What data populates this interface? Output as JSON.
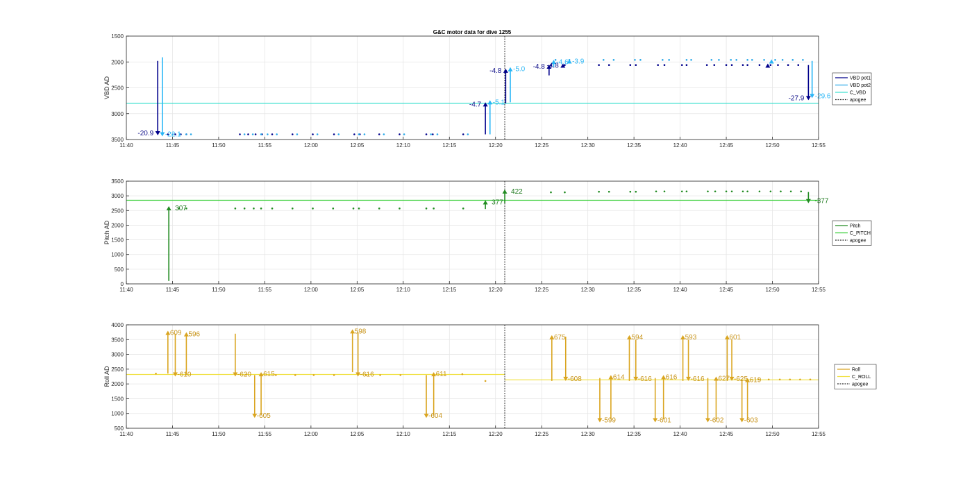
{
  "chart_data": [
    {
      "type": "scatter",
      "title": "G&C motor data for dive 1255",
      "ylabel": "VBD AD",
      "y_reversed": true,
      "ylim": [
        1500,
        3500
      ],
      "yticks": [
        1500,
        2000,
        2500,
        3000,
        3500
      ],
      "xlim": [
        "11:40",
        "12:55"
      ],
      "xticks": [
        "11:40",
        "11:45",
        "11:50",
        "11:55",
        "12:00",
        "12:05",
        "12:10",
        "12:15",
        "12:20",
        "12:25",
        "12:30",
        "12:35",
        "12:40",
        "12:45",
        "12:50",
        "12:55"
      ],
      "grid": true,
      "legend_position": "right",
      "legend": [
        "VBD pot1",
        "VBD pot2",
        "C_VBD",
        "apogee"
      ],
      "colors": {
        "pot1": "#00008b",
        "pot2": "#1e90ff",
        "c_vbd": "#40e0d0",
        "apogee": "#333333"
      },
      "reference_line": {
        "name": "C_VBD",
        "value": 2800
      },
      "apogee": "12:21",
      "pot1_points": {
        "x": [
          "11:44.5",
          "11:45.3",
          "11:45.9",
          "11:46.5",
          "11:52.3",
          "11:53.2",
          "11:54.0",
          "11:54.7",
          "11:55.8",
          "11:58.0",
          "12:00.2",
          "12:02.5",
          "12:04.7",
          "12:05.3",
          "12:07.4",
          "12:09.6",
          "12:12.5",
          "12:13.2",
          "12:16.5",
          "12:26.0",
          "12:27.5",
          "12:31.2",
          "12:32.3",
          "12:34.6",
          "12:35.2",
          "12:37.6",
          "12:38.3",
          "12:40.2",
          "12:40.7",
          "12:42.9",
          "12:43.7",
          "12:45.0",
          "12:45.6",
          "12:46.8",
          "12:47.3",
          "12:48.6",
          "12:49.8",
          "12:50.6",
          "12:51.7",
          "12:52.8"
        ],
        "y": [
          3400,
          3400,
          3400,
          3400,
          3400,
          3400,
          3400,
          3400,
          3400,
          3400,
          3400,
          3400,
          3400,
          3400,
          3400,
          3400,
          3400,
          3400,
          3400,
          2060,
          2060,
          2060,
          2060,
          2060,
          2060,
          2060,
          2060,
          2060,
          2060,
          2060,
          2060,
          2060,
          2060,
          2060,
          2060,
          2060,
          2060,
          2060,
          2060,
          2060
        ]
      },
      "pot2_points": {
        "x": [
          "11:45.0",
          "11:45.8",
          "11:46.5",
          "11:47.0",
          "11:52.8",
          "11:53.7",
          "11:54.6",
          "11:55.3",
          "11:56.3",
          "11:58.5",
          "12:00.7",
          "12:03.0",
          "12:05.2",
          "12:05.8",
          "12:07.9",
          "12:10.1",
          "12:13.0",
          "12:13.7",
          "12:17.0",
          "12:26.5",
          "12:28.0",
          "12:31.7",
          "12:32.8",
          "12:35.1",
          "12:35.7",
          "12:38.1",
          "12:38.8",
          "12:40.7",
          "12:41.2",
          "12:43.4",
          "12:44.2",
          "12:45.5",
          "12:46.1",
          "12:47.3",
          "12:47.8",
          "12:49.1",
          "12:50.3",
          "12:51.1",
          "12:52.2",
          "12:53.3"
        ],
        "y": [
          3400,
          3400,
          3400,
          3400,
          3400,
          3400,
          3400,
          3400,
          3400,
          3400,
          3400,
          3400,
          3400,
          3400,
          3400,
          3400,
          3400,
          3400,
          3400,
          1960,
          1960,
          1960,
          1960,
          1960,
          1960,
          1960,
          1960,
          1960,
          1960,
          1960,
          1960,
          1960,
          1960,
          1960,
          1960,
          1960,
          1960,
          1960,
          1960,
          1960
        ]
      },
      "pot1_arrows": [
        {
          "x": "11:43.4",
          "y0": 1980,
          "y1": 3420,
          "label": "-20.9"
        },
        {
          "x": "12:18.9",
          "y0": 3400,
          "y1": 2780,
          "label": "-4.7"
        },
        {
          "x": "12:21.1",
          "y0": 2800,
          "y1": 2130,
          "label": "-4.8"
        },
        {
          "x": "12:25.8",
          "y0": 2260,
          "y1": 2050,
          "label": "-4.8"
        },
        {
          "x": "12:27.3",
          "y0": 2110,
          "y1": 2030,
          "label": "-4.8"
        },
        {
          "x": "12:49.5",
          "y0": 2060,
          "y1": 2030,
          "label": ""
        },
        {
          "x": "12:53.9",
          "y0": 2060,
          "y1": 2740,
          "label": "-27.9"
        }
      ],
      "pot2_arrows": [
        {
          "x": "11:43.9",
          "y0": 1910,
          "y1": 3440,
          "label": "-22.1"
        },
        {
          "x": "12:19.4",
          "y0": 3400,
          "y1": 2740,
          "label": "-5.1"
        },
        {
          "x": "12:21.6",
          "y0": 2780,
          "y1": 2100,
          "label": "-5.0"
        },
        {
          "x": "12:26.3",
          "y0": 2100,
          "y1": 1960,
          "label": "-4.6"
        },
        {
          "x": "12:28.0",
          "y0": 2000,
          "y1": 1950,
          "label": "-3.9"
        },
        {
          "x": "12:49.9",
          "y0": 1990,
          "y1": 1950,
          "label": ""
        },
        {
          "x": "12:54.3",
          "y0": 1980,
          "y1": 2700,
          "label": "-29.6"
        }
      ]
    },
    {
      "type": "scatter",
      "ylabel": "Pitch AD",
      "ylim": [
        0,
        3500
      ],
      "yticks": [
        0,
        500,
        1000,
        1500,
        2000,
        2500,
        3000,
        3500
      ],
      "xlim": [
        "11:40",
        "12:55"
      ],
      "xticks": [
        "11:40",
        "11:45",
        "11:50",
        "11:55",
        "12:00",
        "12:05",
        "12:10",
        "12:15",
        "12:20",
        "12:25",
        "12:30",
        "12:35",
        "12:40",
        "12:45",
        "12:50",
        "12:55"
      ],
      "grid": true,
      "legend_position": "right",
      "legend": [
        "Pitch",
        "C_PITCH",
        "apogee"
      ],
      "colors": {
        "pitch": "#228b22",
        "c_pitch": "#32cd32",
        "apogee": "#333333"
      },
      "reference_line": {
        "name": "C_PITCH",
        "value": 2850
      },
      "apogee": "12:21",
      "points": {
        "x": [
          "11:45.7",
          "11:46.5",
          "11:51.8",
          "11:52.8",
          "11:53.8",
          "11:54.6",
          "11:55.8",
          "11:58.0",
          "12:00.2",
          "12:02.4",
          "12:04.6",
          "12:05.2",
          "12:07.4",
          "12:09.6",
          "12:12.5",
          "12:13.3",
          "12:16.5",
          "12:26.0",
          "12:27.5",
          "12:31.2",
          "12:32.3",
          "12:34.6",
          "12:35.2",
          "12:37.4",
          "12:38.3",
          "12:40.2",
          "12:40.7",
          "12:43.0",
          "12:43.8",
          "12:45.0",
          "12:45.6",
          "12:46.8",
          "12:47.3",
          "12:48.6",
          "12:49.8",
          "12:50.9",
          "12:52.0",
          "12:53.1"
        ],
        "y": [
          2570,
          2570,
          2570,
          2570,
          2570,
          2570,
          2570,
          2570,
          2570,
          2570,
          2570,
          2570,
          2570,
          2570,
          2570,
          2570,
          2570,
          3120,
          3120,
          3140,
          3140,
          3140,
          3140,
          3150,
          3150,
          3150,
          3150,
          3150,
          3150,
          3150,
          3150,
          3150,
          3150,
          3150,
          3150,
          3150,
          3150,
          3150
        ]
      },
      "arrows": [
        {
          "x": "11:44.6",
          "y0": 100,
          "y1": 2650,
          "label": "307"
        },
        {
          "x": "12:18.9",
          "y0": 2550,
          "y1": 2850,
          "label": "377"
        },
        {
          "x": "12:21.0",
          "y0": 2750,
          "y1": 3220,
          "label": "422"
        },
        {
          "x": "12:53.9",
          "y0": 3130,
          "y1": 2750,
          "label": "-377"
        }
      ]
    },
    {
      "type": "scatter",
      "ylabel": "Roll AD",
      "ylim": [
        500,
        4000
      ],
      "yticks": [
        500,
        1000,
        1500,
        2000,
        2500,
        3000,
        3500,
        4000
      ],
      "xlim": [
        "11:40",
        "12:55"
      ],
      "xticks": [
        "11:40",
        "11:45",
        "11:50",
        "11:55",
        "12:00",
        "12:05",
        "12:10",
        "12:15",
        "12:20",
        "12:25",
        "12:30",
        "12:35",
        "12:40",
        "12:45",
        "12:50",
        "12:55"
      ],
      "grid": true,
      "legend_position": "right",
      "legend": [
        "Roll",
        "C_ROLL",
        "apogee"
      ],
      "colors": {
        "roll": "#daa520",
        "c_roll": "#f0e040",
        "apogee": "#333333"
      },
      "reference_lines": [
        {
          "name": "C_ROLL",
          "x0": "11:40",
          "x1": "12:21",
          "value": 2320
        },
        {
          "name": "C_ROLL",
          "x0": "12:21",
          "x1": "12:55",
          "value": 2140
        }
      ],
      "apogee": "12:21",
      "points": {
        "x": [
          "11:43.2",
          "11:53.0",
          "11:56.2",
          "11:58.3",
          "12:00.3",
          "12:02.5",
          "12:06.0",
          "12:07.5",
          "12:09.7",
          "12:16.4",
          "12:18.9",
          "12:48.5",
          "12:49.6",
          "12:50.8",
          "12:51.9",
          "12:53.0",
          "12:54.1"
        ],
        "y": [
          2350,
          2320,
          2300,
          2300,
          2300,
          2300,
          2300,
          2300,
          2300,
          2330,
          2100,
          2150,
          2150,
          2150,
          2150,
          2150,
          2150
        ]
      },
      "arrows": [
        {
          "x": "11:44.5",
          "y0": 2350,
          "y1": 3800,
          "label": "609"
        },
        {
          "x": "11:45.3",
          "y0": 3700,
          "y1": 2250,
          "label": "-610"
        },
        {
          "x": "11:46.5",
          "y0": 2300,
          "y1": 3750,
          "label": "596"
        },
        {
          "x": "11:51.8",
          "y0": 3700,
          "y1": 2250,
          "label": "-620"
        },
        {
          "x": "11:53.9",
          "y0": 2300,
          "y1": 850,
          "label": "-605"
        },
        {
          "x": "11:54.6",
          "y0": 950,
          "y1": 2400,
          "label": "615"
        },
        {
          "x": "12:04.5",
          "y0": 2400,
          "y1": 3850,
          "label": "598"
        },
        {
          "x": "12:05.1",
          "y0": 3750,
          "y1": 2250,
          "label": "-616"
        },
        {
          "x": "12:12.5",
          "y0": 2300,
          "y1": 850,
          "label": "-604"
        },
        {
          "x": "12:13.3",
          "y0": 950,
          "y1": 2400,
          "label": "611"
        },
        {
          "x": "12:26.1",
          "y0": 2100,
          "y1": 3650,
          "label": "675"
        },
        {
          "x": "12:27.6",
          "y0": 3600,
          "y1": 2100,
          "label": "-608"
        },
        {
          "x": "12:31.3",
          "y0": 2200,
          "y1": 700,
          "label": "-599"
        },
        {
          "x": "12:32.5",
          "y0": 800,
          "y1": 2300,
          "label": "614"
        },
        {
          "x": "12:34.5",
          "y0": 2100,
          "y1": 3650,
          "label": "594"
        },
        {
          "x": "12:35.2",
          "y0": 3500,
          "y1": 2100,
          "label": "-616"
        },
        {
          "x": "12:37.3",
          "y0": 2200,
          "y1": 700,
          "label": "-601"
        },
        {
          "x": "12:38.2",
          "y0": 800,
          "y1": 2300,
          "label": "616"
        },
        {
          "x": "12:40.3",
          "y0": 2100,
          "y1": 3650,
          "label": "593"
        },
        {
          "x": "12:40.9",
          "y0": 3500,
          "y1": 2100,
          "label": "-616"
        },
        {
          "x": "12:43.0",
          "y0": 2200,
          "y1": 700,
          "label": "-602"
        },
        {
          "x": "12:43.9",
          "y0": 800,
          "y1": 2250,
          "label": "627"
        },
        {
          "x": "12:45.1",
          "y0": 2100,
          "y1": 3650,
          "label": "601"
        },
        {
          "x": "12:45.6",
          "y0": 3500,
          "y1": 2100,
          "label": "-625"
        },
        {
          "x": "12:46.7",
          "y0": 2150,
          "y1": 700,
          "label": "-603"
        },
        {
          "x": "12:47.3",
          "y0": 800,
          "y1": 2200,
          "label": "619"
        }
      ]
    }
  ]
}
